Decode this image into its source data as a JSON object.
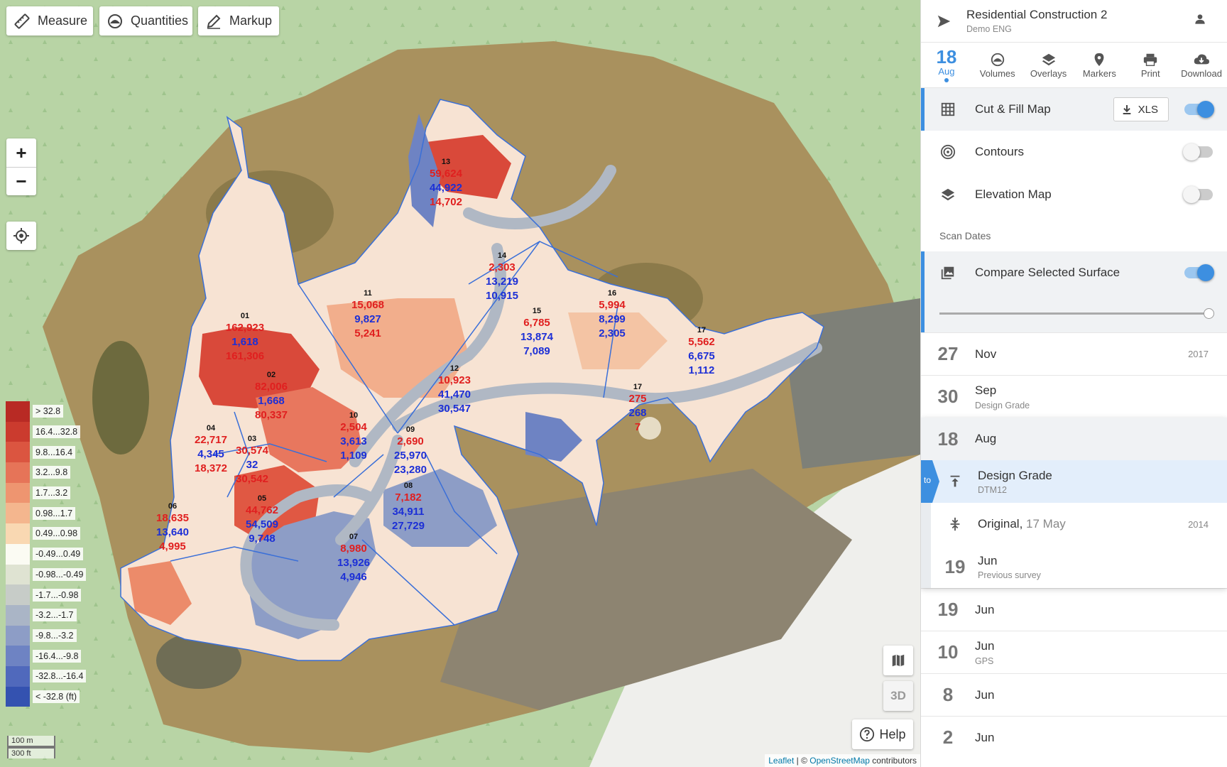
{
  "toolbar": {
    "measure": "Measure",
    "quantities": "Quantities",
    "markup": "Markup"
  },
  "zoom": {
    "in": "+",
    "out": "−"
  },
  "legend": [
    {
      "label": "> 32.8",
      "color": "#b82a24"
    },
    {
      "label": "16.4...32.8",
      "color": "#cb3b2e"
    },
    {
      "label": "9.8...16.4",
      "color": "#db5540"
    },
    {
      "label": "3.2...9.8",
      "color": "#e67458"
    },
    {
      "label": "1.7...3.2",
      "color": "#ee9570"
    },
    {
      "label": "0.98...1.7",
      "color": "#f4b68e"
    },
    {
      "label": "0.49...0.98",
      "color": "#f9d8b2"
    },
    {
      "label": "-0.49...0.49",
      "color": "#fbfbf3"
    },
    {
      "label": "-0.98...-0.49",
      "color": "#dfe3d2"
    },
    {
      "label": "-1.7...-0.98",
      "color": "#c7ccc8"
    },
    {
      "label": "-3.2...-1.7",
      "color": "#aab5c6"
    },
    {
      "label": "-9.8...-3.2",
      "color": "#8d9dc6"
    },
    {
      "label": "-16.4...-9.8",
      "color": "#6e83c3"
    },
    {
      "label": "-32.8...-16.4",
      "color": "#5069bc"
    },
    {
      "label": "< -32.8 (ft)",
      "color": "#3452b0"
    }
  ],
  "scale": {
    "metric": "100 m",
    "imperial": "300 ft"
  },
  "map_controls": {
    "three_d": "3D",
    "help": "Help"
  },
  "attribution": {
    "leaflet": "Leaflet",
    "sep": " | © ",
    "osm": "OpenStreetMap",
    "tail": " contributors"
  },
  "regions": [
    {
      "id": "01",
      "cut": "162,923",
      "fill": "1,618",
      "net": "161,306",
      "net_sign": "cut"
    },
    {
      "id": "02",
      "cut": "82,006",
      "fill": "1,668",
      "net": "80,337",
      "net_sign": "cut"
    },
    {
      "id": "03",
      "cut": "30,574",
      "fill": "32",
      "net": "30,542",
      "net_sign": "cut"
    },
    {
      "id": "04",
      "cut": "22,717",
      "fill": "4,345",
      "net": "18,372",
      "net_sign": "cut"
    },
    {
      "id": "05",
      "cut": "44,762",
      "fill": "54,509",
      "net": "9,748",
      "net_sign": "fill"
    },
    {
      "id": "06",
      "cut": "18,635",
      "fill": "13,640",
      "net": "4,995",
      "net_sign": "cut"
    },
    {
      "id": "07",
      "cut": "8,980",
      "fill": "13,926",
      "net": "4,946",
      "net_sign": "fill"
    },
    {
      "id": "08",
      "cut": "7,182",
      "fill": "34,911",
      "net": "27,729",
      "net_sign": "fill"
    },
    {
      "id": "09",
      "cut": "2,690",
      "fill": "25,970",
      "net": "23,280",
      "net_sign": "fill"
    },
    {
      "id": "10",
      "cut": "2,504",
      "fill": "3,613",
      "net": "1,109",
      "net_sign": "fill"
    },
    {
      "id": "11",
      "cut": "15,068",
      "fill": "9,827",
      "net": "5,241",
      "net_sign": "cut"
    },
    {
      "id": "12",
      "cut": "10,923",
      "fill": "41,470",
      "net": "30,547",
      "net_sign": "fill"
    },
    {
      "id": "13",
      "cut": "59,624",
      "fill": "44,922",
      "net": "14,702",
      "net_sign": "cut"
    },
    {
      "id": "14",
      "cut": "2,303",
      "fill": "13,219",
      "net": "10,915",
      "net_sign": "fill"
    },
    {
      "id": "15",
      "cut": "6,785",
      "fill": "13,874",
      "net": "7,089",
      "net_sign": "fill"
    },
    {
      "id": "16",
      "cut": "5,994",
      "fill": "8,299",
      "net": "2,305",
      "net_sign": "fill"
    },
    {
      "id": "17",
      "cut": "5,562",
      "fill": "6,675",
      "net": "1,112",
      "net_sign": "fill"
    },
    {
      "id": "17",
      "cut": "275",
      "fill": "268",
      "net": "7",
      "net_sign": "cut"
    }
  ],
  "sidebar": {
    "project": "Residential Construction 2",
    "org": "Demo ENG",
    "tabs": {
      "date_day": "18",
      "date_month": "Aug",
      "volumes": "Volumes",
      "overlays": "Overlays",
      "markers": "Markers",
      "print": "Print",
      "download": "Download"
    },
    "layers": {
      "cut_fill": "Cut & Fill Map",
      "xls": "XLS",
      "contours": "Contours",
      "elevation": "Elevation Map",
      "cut_fill_on": true,
      "contours_on": false,
      "elevation_on": false
    },
    "scan_dates_title": "Scan Dates",
    "compare_label": "Compare Selected Surface",
    "compare_on": true,
    "compare_slider_value": 1.0,
    "dates": [
      {
        "day": "27",
        "month": "Nov",
        "year": "2017",
        "sub": ""
      },
      {
        "day": "30",
        "month": "Sep",
        "year": "",
        "sub": "Design Grade"
      }
    ],
    "selected_date": {
      "day": "18",
      "month": "Aug",
      "to_tag": "to",
      "design_label": "Design Grade",
      "design_sub": "DTM12",
      "original_label": "Original,",
      "original_date": " 17 May",
      "original_year": "2014",
      "prev_day": "19",
      "prev_month": "Jun",
      "prev_sub": "Previous survey"
    },
    "dates_after": [
      {
        "day": "19",
        "month": "Jun",
        "sub": ""
      },
      {
        "day": "10",
        "month": "Jun",
        "sub": "GPS"
      },
      {
        "day": "8",
        "month": "Jun",
        "sub": ""
      },
      {
        "day": "2",
        "month": "Jun",
        "sub": ""
      }
    ]
  }
}
